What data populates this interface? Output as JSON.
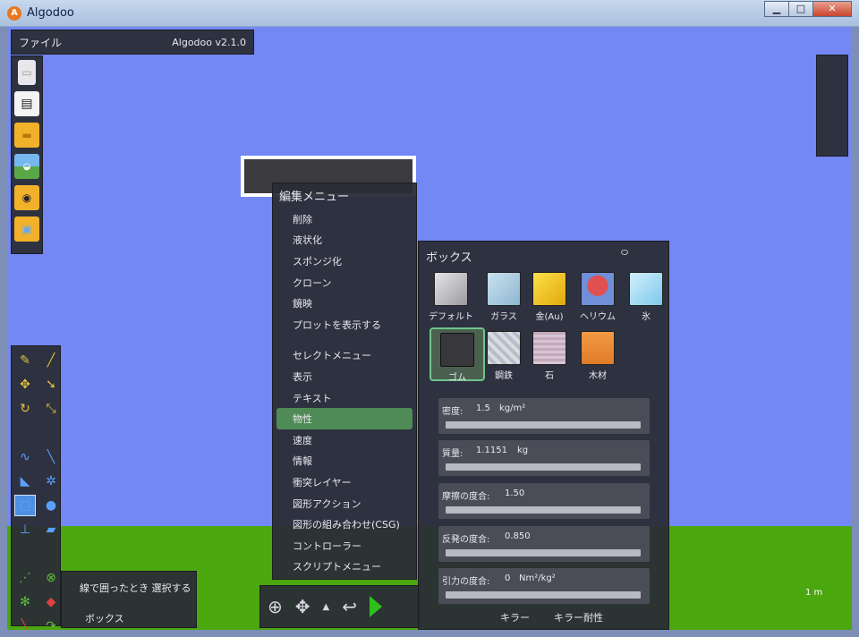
{
  "window": {
    "title": "Algodoo",
    "min": "▁",
    "max": "□",
    "close": "✕"
  },
  "filebar": {
    "file_menu": "ファイル",
    "version": "Algodoo v2.1.0"
  },
  "left_tools": [
    "new-scene-icon",
    "toolbar-icon",
    "open-folder-icon",
    "open-scene-icon",
    "scenes-folder-icon",
    "image-folder-icon"
  ],
  "scale": {
    "label": "1 m"
  },
  "status": {
    "select_mode": "線で囲ったとき 選択する",
    "object_name": "ボックス"
  },
  "edit_menu": {
    "title": "編集メニュー",
    "items": [
      "削除",
      "液状化",
      "スポンジ化",
      "クローン",
      "鏡映",
      "プロットを表示する"
    ],
    "sub_items": [
      "セレクトメニュー",
      "表示",
      "テキスト",
      "物性",
      "速度",
      "情報",
      "衝突レイヤー",
      "図形アクション",
      "図形の組み合わせ(CSG)",
      "コントローラー",
      "スクリプトメニュー"
    ]
  },
  "material_panel": {
    "title": "ボックス",
    "materials": [
      {
        "name": "デフォルト",
        "color": "#b8b8bc"
      },
      {
        "name": "ガラス",
        "color": "#9fc6de"
      },
      {
        "name": "金(Au)",
        "color": "#f2c51c"
      },
      {
        "name": "ヘリウム",
        "color": "#cc3a3a"
      },
      {
        "name": "氷",
        "color": "#a6dcf4"
      },
      {
        "name": "ゴム",
        "color": "#38383c"
      },
      {
        "name": "鋼鉄",
        "color": "#c6cbd6"
      },
      {
        "name": "石",
        "color": "#c9b3c4"
      },
      {
        "name": "木材",
        "color": "#e8893a"
      }
    ],
    "properties": [
      {
        "label": "密度:",
        "value": "1.5",
        "unit": "kg/m²"
      },
      {
        "label": "質量:",
        "value": "1.1151",
        "unit": "kg"
      },
      {
        "label": "摩擦の度合:",
        "value": "1.50",
        "unit": ""
      },
      {
        "label": "反発の度合:",
        "value": "0.850",
        "unit": ""
      },
      {
        "label": "引力の度合:",
        "value": "0",
        "unit": "Nm²/kg²"
      }
    ],
    "footer": {
      "killer": "キラー",
      "killer_resist": "キラー耐性"
    }
  },
  "colors": {
    "sky": "#7388f5",
    "ground": "#4aa70e",
    "panel": "#2a2c36",
    "highlight": "#4f8b56"
  }
}
